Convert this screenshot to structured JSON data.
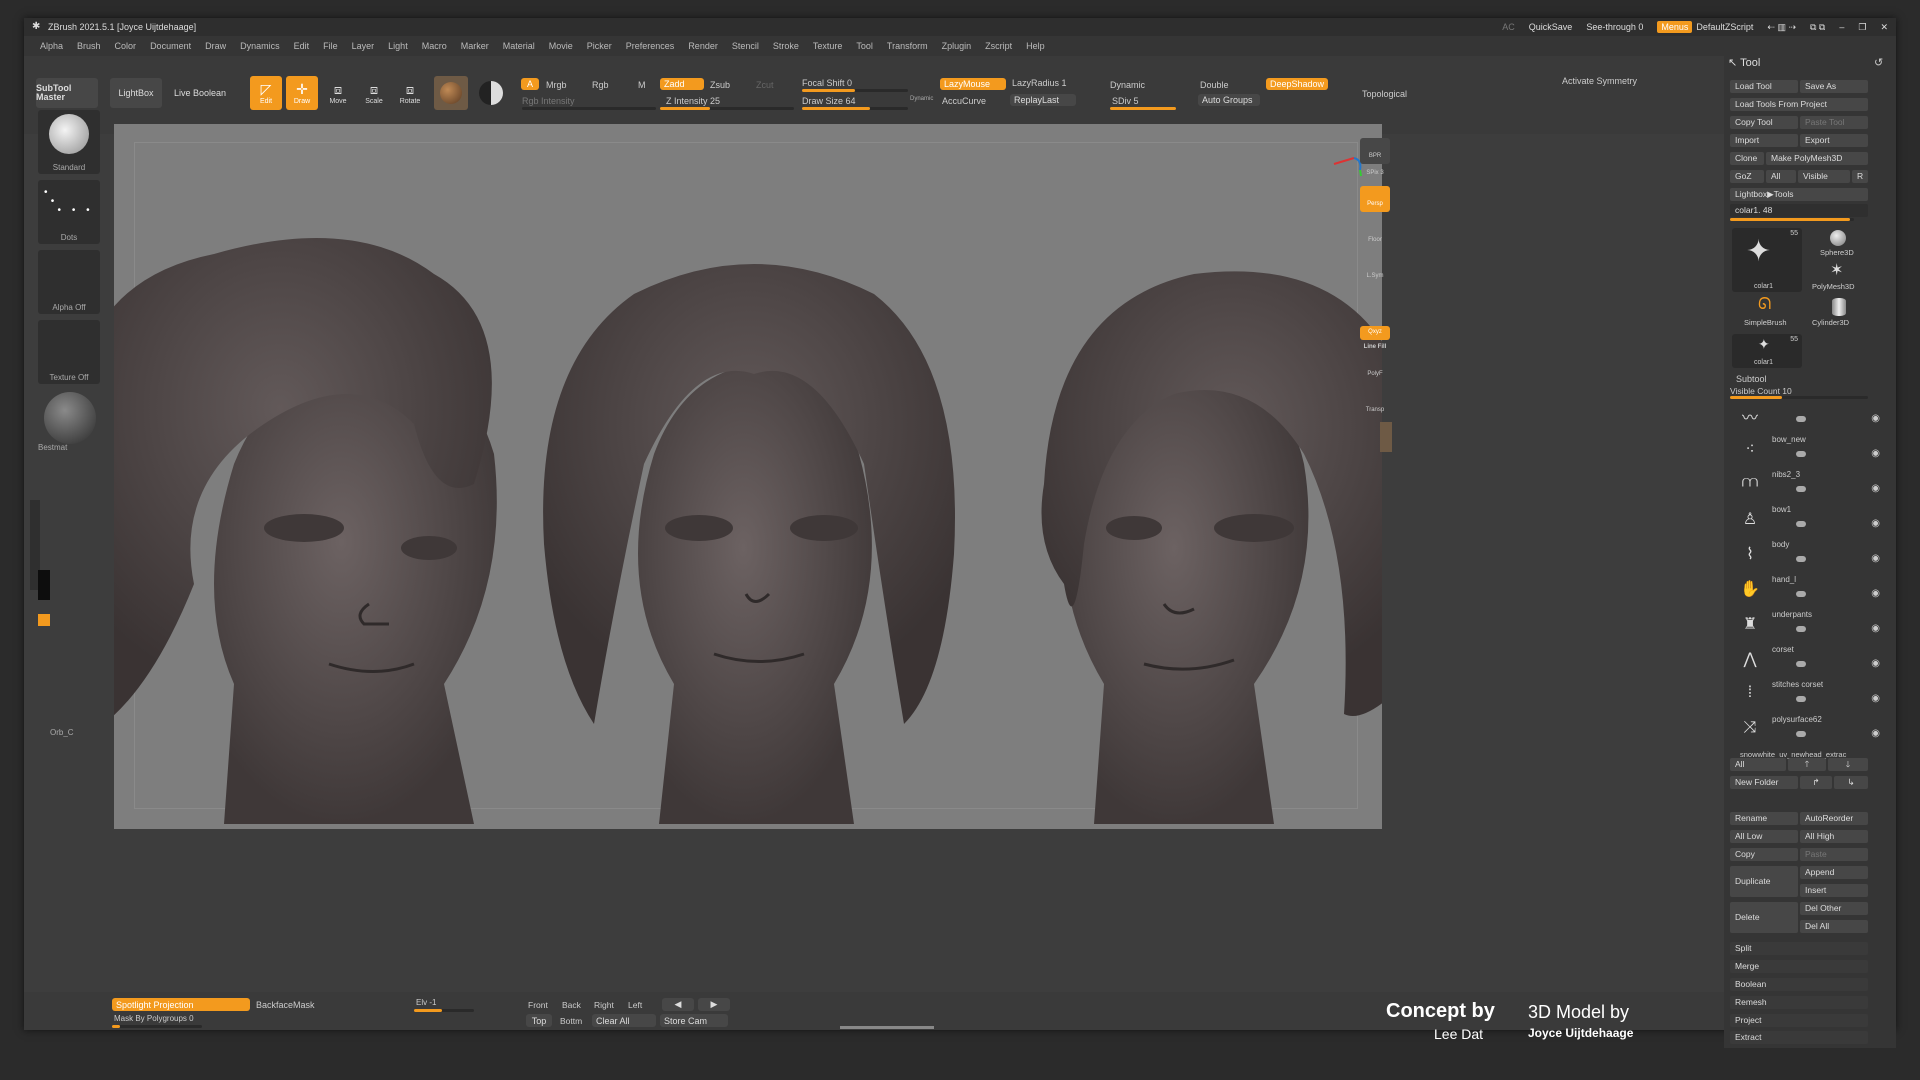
{
  "title": "ZBrush 2021.5.1 [Joyce Uijtdehaage]",
  "titlebar_right": {
    "ac": "AC",
    "quicksave": "QuickSave",
    "see_through": "See-through  0",
    "menus": "Menus",
    "script": "DefaultZScript"
  },
  "menu": [
    "Alpha",
    "Brush",
    "Color",
    "Document",
    "Draw",
    "Dynamics",
    "Edit",
    "File",
    "Layer",
    "Light",
    "Macro",
    "Marker",
    "Material",
    "Movie",
    "Picker",
    "Preferences",
    "Render",
    "Stencil",
    "Stroke",
    "Texture",
    "Tool",
    "Transform",
    "Zplugin",
    "Zscript",
    "Help"
  ],
  "toolbar": {
    "subtool_master": "SubTool Master",
    "lightbox": "LightBox",
    "live_boolean": "Live Boolean",
    "edit": "Edit",
    "draw": "Draw",
    "move": "Move",
    "scale": "Scale",
    "rotate": "Rotate",
    "a": "A",
    "mrgb": "Mrgb",
    "rgb": "Rgb",
    "m": "M",
    "rgb_intensity": "Rgb Intensity",
    "zadd": "Zadd",
    "zsub": "Zsub",
    "zcut": "Zcut",
    "z_intensity": "Z Intensity 25",
    "focal_shift": "Focal Shift 0",
    "draw_size": "Draw Size 64",
    "dynamic_small": "Dynamic",
    "lazymouse": "LazyMouse",
    "lazyradius": "LazyRadius 1",
    "accucurve": "AccuCurve",
    "replaylast": "ReplayLast",
    "dynamic": "Dynamic",
    "sdiv": "SDiv 5",
    "double": "Double",
    "deepshadow": "DeepShadow",
    "auto_groups": "Auto Groups",
    "topological": "Topological",
    "activate_symmetry": "Activate Symmetry"
  },
  "leftbar": {
    "standard": "Standard",
    "dots": "Dots",
    "alpha_off": "Alpha Off",
    "texture_off": "Texture Off",
    "material": "Bestmat",
    "orb": "Orb_C"
  },
  "rightdock": [
    "BPR",
    "SPix 3",
    "Persp",
    "Floor",
    "L.Sym",
    "",
    "Qxyz",
    "Line Fill",
    "PolyF",
    "Transp"
  ],
  "tool_panel": {
    "header": "Tool",
    "buttons": [
      [
        "Load Tool",
        "Save As"
      ],
      [
        "Load Tools From Project",
        ""
      ],
      [
        "Copy Tool",
        "Paste Tool"
      ],
      [
        "Import",
        "Export"
      ],
      [
        "Clone",
        "Make PolyMesh3D"
      ],
      [
        "GoZ",
        "All",
        "Visible",
        "R"
      ]
    ],
    "lightbox_tools": "Lightbox▶Tools",
    "current": "colar1. 48",
    "thumbs": [
      {
        "name": "colar1",
        "count": "55"
      },
      {
        "name": "Sphere3D"
      },
      {
        "name": "PolyMesh3D"
      },
      {
        "name": "SimpleBrush"
      },
      {
        "name": "Cylinder3D"
      },
      {
        "name": "colar1",
        "count": "55"
      }
    ],
    "subtool_header": "Subtool",
    "visible_count": "Visible Count 10",
    "subtools": [
      "",
      "bow_new",
      "nibs2_3",
      "bow1",
      "body",
      "hand_l",
      "underpants",
      "corset",
      "stitches corset",
      "polysurface62",
      "snowwhite_uv_newhead_extrac"
    ],
    "all": "All",
    "new_folder": "New Folder",
    "actions": [
      [
        "Rename",
        "AutoReorder"
      ],
      [
        "All Low",
        "All High"
      ],
      [
        "Copy",
        "Paste"
      ]
    ],
    "duplicate": "Duplicate",
    "append": "Append",
    "insert": "Insert",
    "delete": "Delete",
    "del_other": "Del Other",
    "del_all": "Del All",
    "list": [
      "Split",
      "Merge",
      "Boolean",
      "Remesh",
      "Project",
      "Extract"
    ]
  },
  "bottom": {
    "spotlight": "Spotlight Projection",
    "backfacemask": "BackfaceMask",
    "mask_polygroups": "Mask By Polygroups 0",
    "elv": "Elv -1",
    "front": "Front",
    "back": "Back",
    "right": "Right",
    "left": "Left",
    "top": "Top",
    "bottom": "Bottm",
    "clear_all": "Clear All",
    "store_cam": "Store Cam"
  },
  "credits": {
    "concept_label": "Concept by",
    "concept_name": "Lee Dat",
    "model_label": "3D Model by",
    "model_name": "Joyce Uijtdehaage"
  },
  "colors": {
    "accent": "#f39a1e",
    "viewport": "#7e7e7e",
    "panel": "#353535",
    "clay": "#5a5252"
  }
}
